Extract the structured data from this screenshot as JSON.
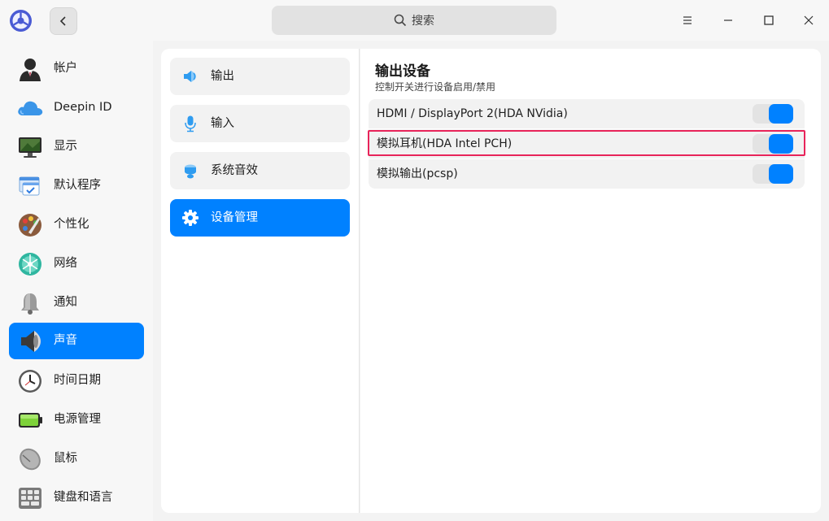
{
  "titlebar": {
    "app_icon": "deepin-control-center-icon",
    "back_icon": "chevron-left-icon",
    "search": {
      "icon": "search-icon",
      "placeholder": "搜索"
    },
    "window_controls": [
      "menu-icon",
      "maximize-icon",
      "close-icon"
    ]
  },
  "sidebar": {
    "items": [
      {
        "label": "帐户",
        "icon": "account-icon",
        "active": false
      },
      {
        "label": "Deepin ID",
        "icon": "cloud-icon",
        "active": false
      },
      {
        "label": "显示",
        "icon": "display-icon",
        "active": false
      },
      {
        "label": "默认程序",
        "icon": "default-apps-icon",
        "active": false
      },
      {
        "label": "个性化",
        "icon": "personalization-icon",
        "active": false
      },
      {
        "label": "网络",
        "icon": "network-icon",
        "active": false
      },
      {
        "label": "通知",
        "icon": "notification-bell-icon",
        "active": false
      },
      {
        "label": "声音",
        "icon": "speaker-icon",
        "active": true
      },
      {
        "label": "时间日期",
        "icon": "clock-icon",
        "active": false
      },
      {
        "label": "电源管理",
        "icon": "battery-icon",
        "active": false
      },
      {
        "label": "鼠标",
        "icon": "mouse-icon",
        "active": false
      },
      {
        "label": "键盘和语言",
        "icon": "keyboard-icon",
        "active": false
      }
    ]
  },
  "sound_menu": {
    "items": [
      {
        "label": "输出",
        "icon": "output-speaker-icon",
        "active": false
      },
      {
        "label": "输入",
        "icon": "microphone-icon",
        "active": false
      },
      {
        "label": "系统音效",
        "icon": "sound-effects-icon",
        "active": false
      },
      {
        "label": "设备管理",
        "icon": "gear-icon",
        "active": true
      }
    ]
  },
  "content": {
    "title": "输出设备",
    "subtitle": "控制开关进行设备启用/禁用",
    "devices": [
      {
        "label": "HDMI / DisplayPort 2(HDA NVidia)",
        "enabled": true
      },
      {
        "label": "模拟耳机(HDA Intel PCH)",
        "enabled": true
      },
      {
        "label": "模拟输出(pcsp)",
        "enabled": true
      }
    ]
  },
  "colors": {
    "accent": "#0081ff",
    "highlight_border": "#e8245a",
    "window_bg": "#f3f3f3"
  }
}
